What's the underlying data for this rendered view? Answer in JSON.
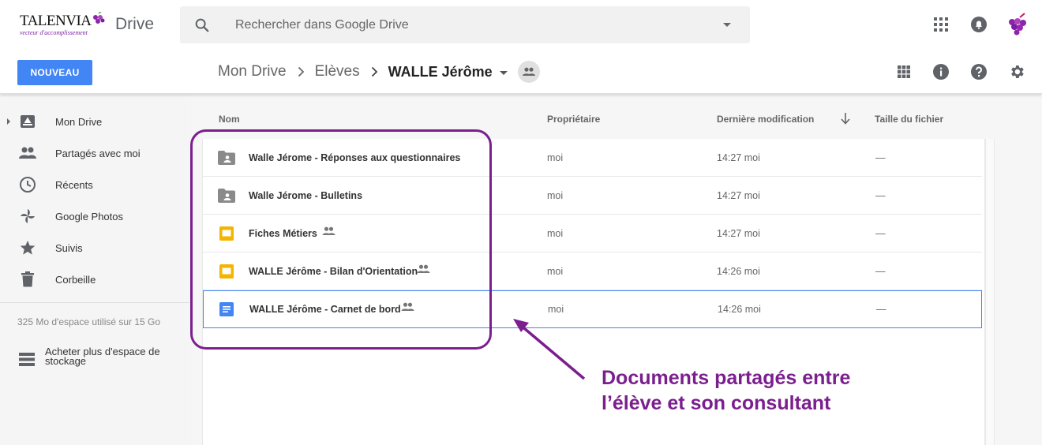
{
  "app": {
    "logo_text": "TALENVIA",
    "logo_tagline": "vecteur d'accomplissement",
    "product": "Drive"
  },
  "search": {
    "placeholder": "Rechercher dans Google Drive"
  },
  "toolbar": {
    "new_label": "NOUVEAU"
  },
  "breadcrumb": {
    "root": "Mon Drive",
    "parent": "Elèves",
    "current": "WALLE Jérôme"
  },
  "sidebar": {
    "items": [
      {
        "label": "Mon Drive",
        "icon": "drive-icon"
      },
      {
        "label": "Partagés avec moi",
        "icon": "shared-people-icon"
      },
      {
        "label": "Récents",
        "icon": "clock-icon"
      },
      {
        "label": "Google Photos",
        "icon": "pinwheel-icon"
      },
      {
        "label": "Suivis",
        "icon": "star-icon"
      },
      {
        "label": "Corbeille",
        "icon": "trash-icon"
      }
    ],
    "storage": "325 Mo d'espace utilisé sur 15 Go",
    "buy_storage": "Acheter plus d'espace de stockage"
  },
  "columns": {
    "name": "Nom",
    "owner": "Propriétaire",
    "modified": "Dernière modification",
    "size": "Taille du fichier"
  },
  "files": [
    {
      "name": "Walle Jérome - Réponses aux questionnaires",
      "type": "shared-folder",
      "shared": false,
      "owner": "moi",
      "modified": "14:27  moi",
      "size": "—"
    },
    {
      "name": "Walle Jérome - Bulletins",
      "type": "shared-folder",
      "shared": false,
      "owner": "moi",
      "modified": "14:27  moi",
      "size": "—"
    },
    {
      "name": "Fiches Métiers",
      "type": "slides",
      "shared": true,
      "owner": "moi",
      "modified": "14:27  moi",
      "size": "—"
    },
    {
      "name": "WALLE Jérôme - Bilan d'Orientation",
      "type": "slides",
      "shared": true,
      "owner": "moi",
      "modified": "14:26  moi",
      "size": "—"
    },
    {
      "name": "WALLE Jérôme - Carnet de bord",
      "type": "docs",
      "shared": true,
      "owner": "moi",
      "modified": "14:26  moi",
      "size": "—"
    }
  ],
  "annotation": {
    "line1": "Documents partagés entre",
    "line2": "l’élève et son consultant"
  },
  "colors": {
    "accent": "#4285f4",
    "annotation": "#7b1f8f",
    "slides": "#f4b400",
    "docs": "#4285f4",
    "folder": "#8a8a8a"
  }
}
